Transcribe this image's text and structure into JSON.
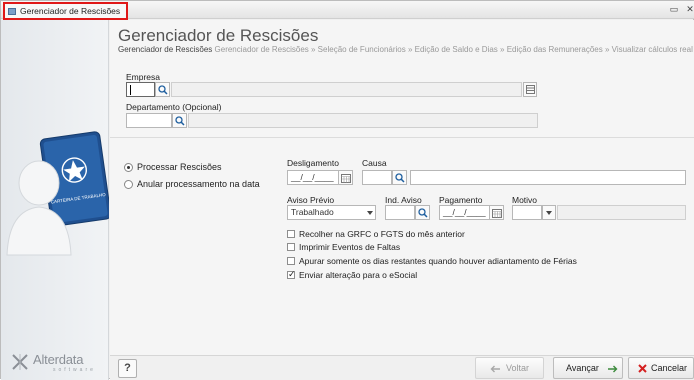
{
  "window": {
    "title": "Gerenciador de Rescisões",
    "restore_glyph": "▭",
    "close_glyph": "✕"
  },
  "header": {
    "title": "Gerenciador de Rescisões",
    "breadcrumb": {
      "current": "Gerenciador de Rescisões",
      "rest": "Gerenciador de Rescisões » Seleção de Funcionários » Edição de Saldo e Dias » Edição das Remunerações » Visualizar cálculos real"
    }
  },
  "brand": {
    "name": "Alterdata",
    "sub": "software",
    "illustration_card_text": "CARTEIRA DE TRABALHO"
  },
  "form": {
    "empresa": {
      "label": "Empresa",
      "value": ""
    },
    "departamento": {
      "label": "Departamento (Opcional)",
      "value": ""
    },
    "radio_processar": {
      "label": "Processar Rescisões",
      "checked": true
    },
    "radio_anular": {
      "label": "Anular processamento na data",
      "checked": false
    },
    "desligamento": {
      "label": "Desligamento",
      "value": "__/__/____"
    },
    "causa": {
      "label": "Causa",
      "value": ""
    },
    "aviso_previo": {
      "label": "Aviso Prévio",
      "value": "Trabalhado"
    },
    "ind_aviso": {
      "label": "Ind. Aviso",
      "value": ""
    },
    "pagamento": {
      "label": "Pagamento",
      "value": "__/__/____"
    },
    "motivo": {
      "label": "Motivo",
      "value": ""
    },
    "checkboxes": [
      {
        "label": "Recolher na GRFC o FGTS do mês anterior",
        "checked": false
      },
      {
        "label": "Imprimir Eventos de Faltas",
        "checked": false
      },
      {
        "label": "Apurar somente os dias restantes quando houver adiantamento de Férias",
        "checked": false
      },
      {
        "label": "Enviar alteração para o eSocial",
        "checked": true
      }
    ]
  },
  "footer": {
    "help_label": "?",
    "back_label": "Voltar",
    "next_label": "Avançar",
    "cancel_label": "Cancelar"
  },
  "colors": {
    "highlight": "#e01818",
    "cancel_icon": "#d42020",
    "next_arrow": "#3c8a3c"
  }
}
